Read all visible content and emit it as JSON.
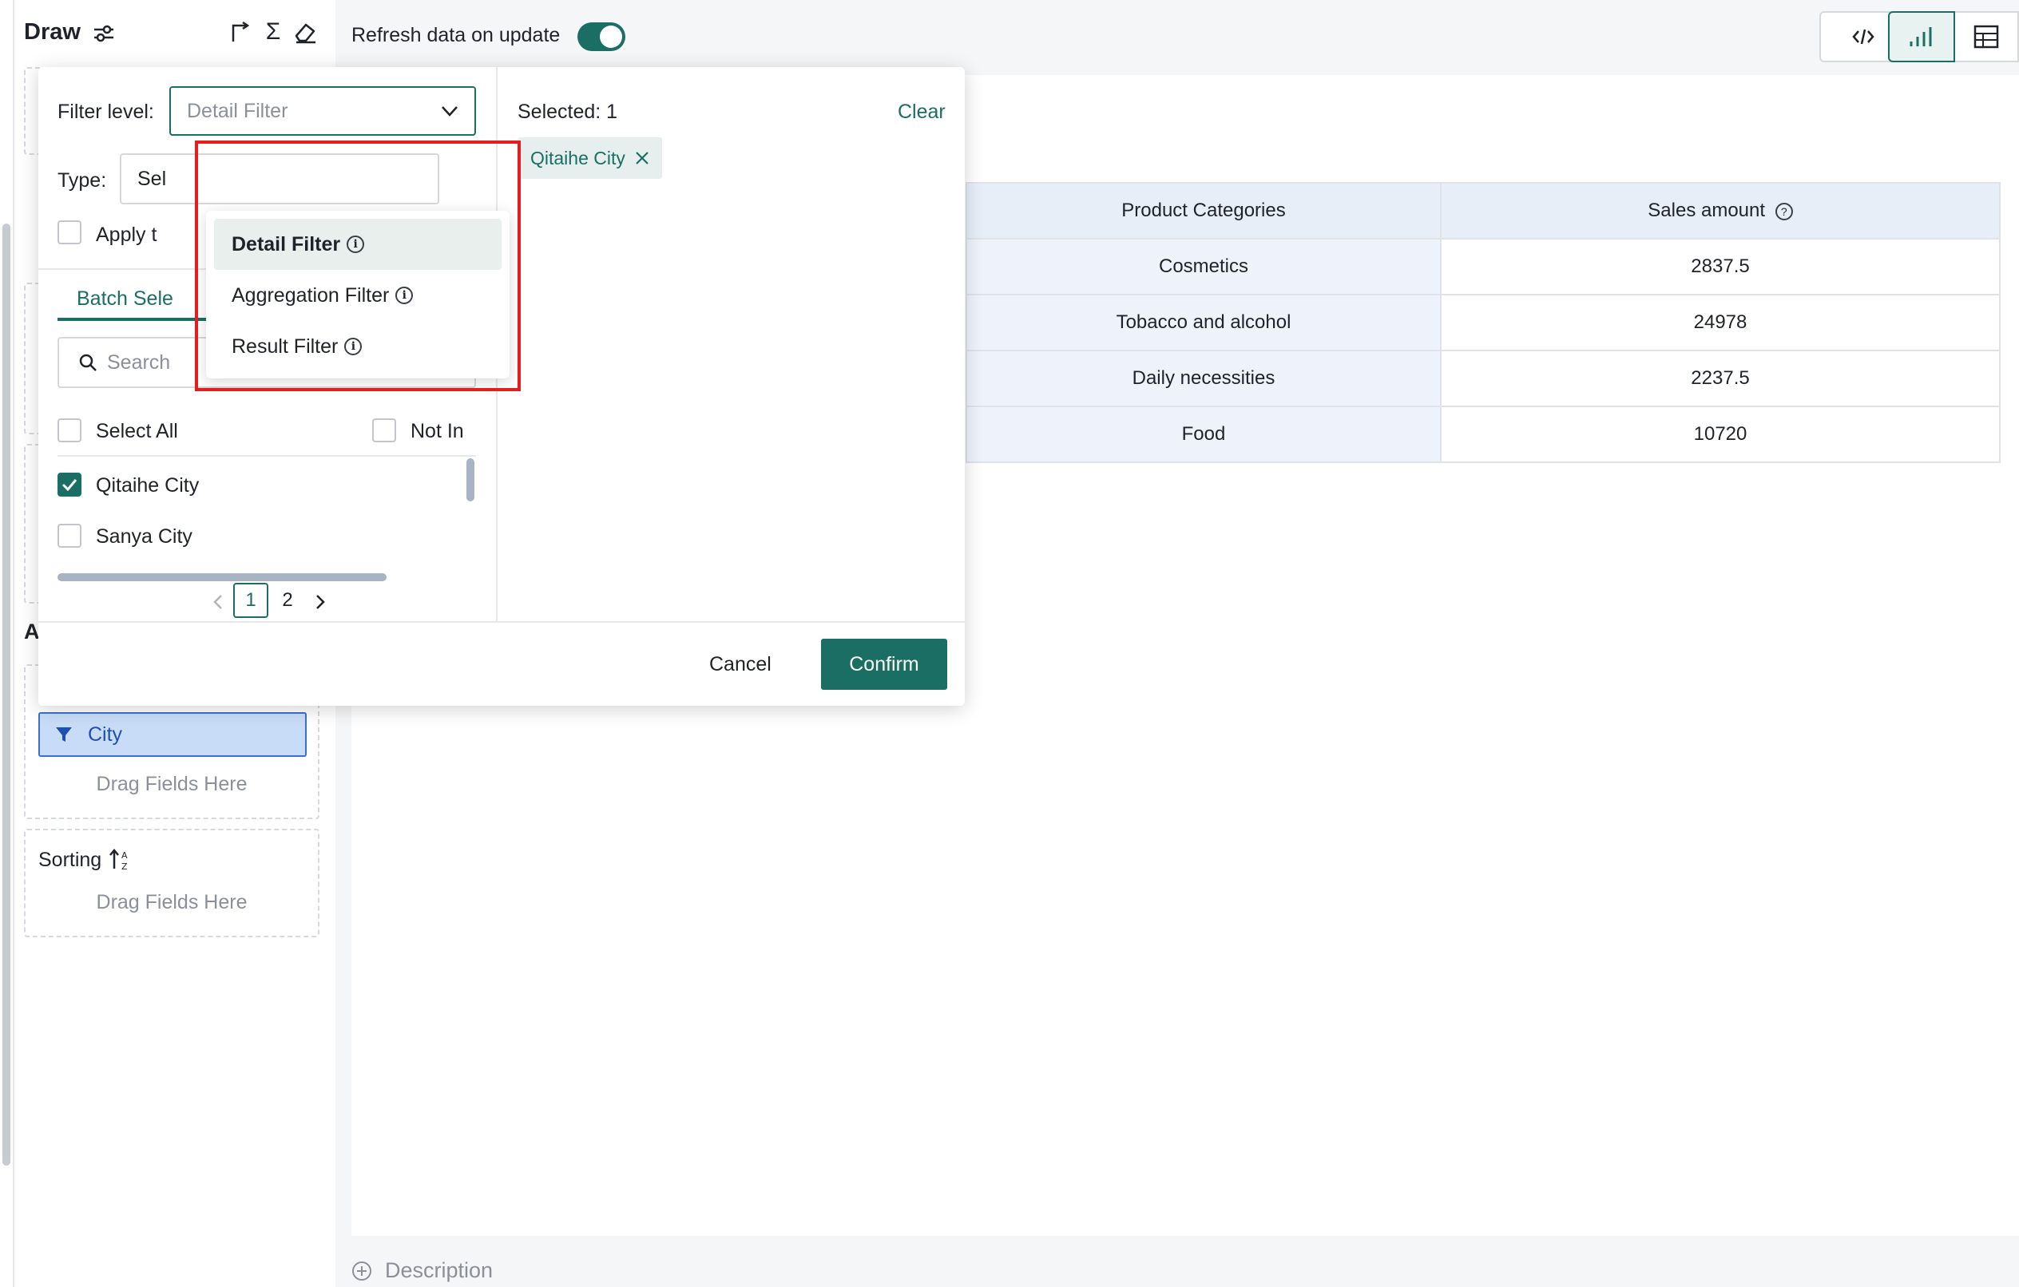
{
  "sidebar": {
    "title": "Draw",
    "agg_section_partial_label": "A",
    "filter_field": "City",
    "drag_placeholder_1": "Drag Fields Here",
    "sorting_label": "Sorting",
    "drag_placeholder_2": "Drag Fields Here"
  },
  "header": {
    "refresh_label": "Refresh data on update",
    "refresh_enabled": true
  },
  "table": {
    "columns": [
      "Product Categories",
      "Sales amount"
    ],
    "rows": [
      [
        "Cosmetics",
        "2837.5"
      ],
      [
        "Tobacco and alcohol",
        "24978"
      ],
      [
        "Daily necessities",
        "2237.5"
      ],
      [
        "Food",
        "10720"
      ]
    ]
  },
  "description_label": "Description",
  "filter_dialog": {
    "filter_level_label": "Filter level:",
    "filter_level_value": "Detail Filter",
    "type_label": "Type:",
    "type_value_partial": "Sel",
    "apply_label_partial": "Apply t",
    "tab_label_partial": "Batch Sele",
    "search_placeholder": "Search",
    "select_all_label": "Select All",
    "not_in_label": "Not In",
    "options": [
      {
        "label": "Qitaihe City",
        "checked": true
      },
      {
        "label": "Sanya City",
        "checked": false
      }
    ],
    "pagination": {
      "current": "1",
      "next_page": "2"
    },
    "selected_label": "Selected: 1",
    "clear_label": "Clear",
    "selected_tags": [
      "Qitaihe City"
    ],
    "cancel_label": "Cancel",
    "confirm_label": "Confirm",
    "dropdown": {
      "items": [
        "Detail Filter",
        "Aggregation Filter",
        "Result Filter"
      ],
      "active_index": 0
    }
  },
  "colors": {
    "accent": "#1b6e63",
    "highlight_border": "#e41e1e",
    "filter_chip_bg": "#c9dcf7",
    "filter_chip_border": "#3b6fd1"
  }
}
